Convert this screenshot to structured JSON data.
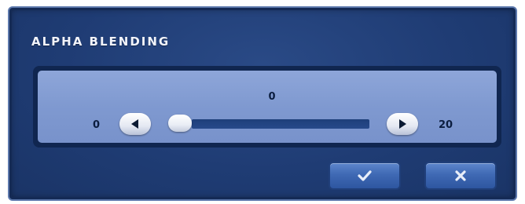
{
  "dialog": {
    "title": "ALPHA BLENDING"
  },
  "slider": {
    "current_value": "0",
    "min_label": "0",
    "max_label": "20",
    "value": 0,
    "min": 0,
    "max": 20
  },
  "buttons": {
    "decrease_icon": "left-arrow-icon",
    "increase_icon": "right-arrow-icon",
    "confirm_icon": "checkmark-icon",
    "cancel_icon": "close-icon"
  },
  "colors": {
    "dialog_background": "#1f3c74",
    "panel_background": "#8099d1",
    "track": "#22457f",
    "button": "#3f69b4"
  }
}
